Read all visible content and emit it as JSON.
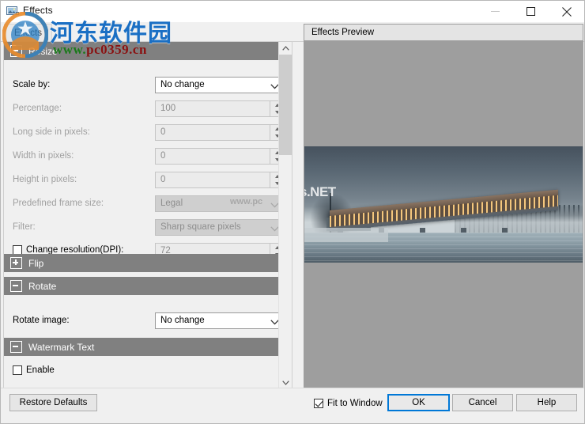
{
  "window": {
    "title": "Effects",
    "icon": "image-effects-icon",
    "controls": {
      "minimize": "minimize-icon",
      "maximize": "maximize-icon",
      "close": "close-icon"
    }
  },
  "tabs": [
    {
      "label": "Effects"
    }
  ],
  "sections": [
    {
      "id": "resize",
      "title": "Resize",
      "expanded": true,
      "expander_glyph": "minus",
      "fields": [
        {
          "label": "Scale by:",
          "type": "combo",
          "value": "No change",
          "enabled": true
        },
        {
          "label": "Percentage:",
          "type": "spin",
          "value": "100",
          "enabled": false
        },
        {
          "label": "Long side in pixels:",
          "type": "spin",
          "value": "0",
          "enabled": false
        },
        {
          "label": "Width in pixels:",
          "type": "spin",
          "value": "0",
          "enabled": false
        },
        {
          "label": "Height in pixels:",
          "type": "spin",
          "value": "0",
          "enabled": false
        },
        {
          "label": "Predefined frame size:",
          "type": "combo",
          "value": "Legal",
          "enabled": false
        },
        {
          "label": "Filter:",
          "type": "combo",
          "value": "Sharp square pixels",
          "enabled": false
        }
      ],
      "checkbox_field": {
        "label": "Change resolution(DPI):",
        "checked": false,
        "value": "72"
      }
    },
    {
      "id": "flip",
      "title": "Flip",
      "expanded": false,
      "expander_glyph": "plus"
    },
    {
      "id": "rotate",
      "title": "Rotate",
      "expanded": true,
      "expander_glyph": "minus",
      "fields": [
        {
          "label": "Rotate image:",
          "type": "combo",
          "value": "No change",
          "enabled": true
        }
      ]
    },
    {
      "id": "watermark-text",
      "title": "Watermark Text",
      "expanded": true,
      "expander_glyph": "minus",
      "enable_checkbox": {
        "label": "Enable",
        "checked": false
      }
    }
  ],
  "preview": {
    "header": "Effects Preview",
    "image_alt": "architectural rendering of an illuminated bridge building over a misty frozen lake",
    "image_watermark": "s.NET"
  },
  "footer": {
    "restore_defaults": "Restore Defaults",
    "fit_to_window": {
      "label": "Fit to Window",
      "checked": true
    },
    "ok": "OK",
    "cancel": "Cancel",
    "help": "Help"
  },
  "site_watermark": {
    "text_cn": "河东软件园",
    "url_prefix": "www.",
    "url_main": "pc0359.cn",
    "small": "www.pc"
  },
  "colors": {
    "section_header_bg": "#808080",
    "accent_focus": "#0078d7",
    "panel_bg": "#f0f0f0",
    "preview_bg": "#9e9e9e",
    "watermark_blue": "#1a6fc4",
    "watermark_green": "#1a7a1a",
    "watermark_red": "#8a1111"
  }
}
